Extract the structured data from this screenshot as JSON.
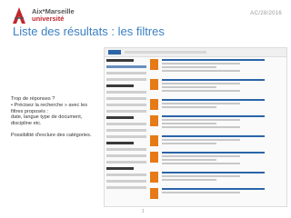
{
  "header": {
    "logo_line1": "Aix*Marseille",
    "logo_line2": "université",
    "date": "AC/28/2016"
  },
  "slide": {
    "title": "Liste des résultats : les filtres",
    "paragraph1": "Trop de réponses ?\n• Précisez la recherche » avec les filtres proposés :\ndate, langue type de document, discipline etc.",
    "paragraph2": "Possibilité d'exclure des catégories."
  },
  "footer": {
    "page_number": "1"
  },
  "colors": {
    "title_blue": "#3a7fc3",
    "brand_red": "#c0272d",
    "thumb_orange": "#e57a16"
  }
}
